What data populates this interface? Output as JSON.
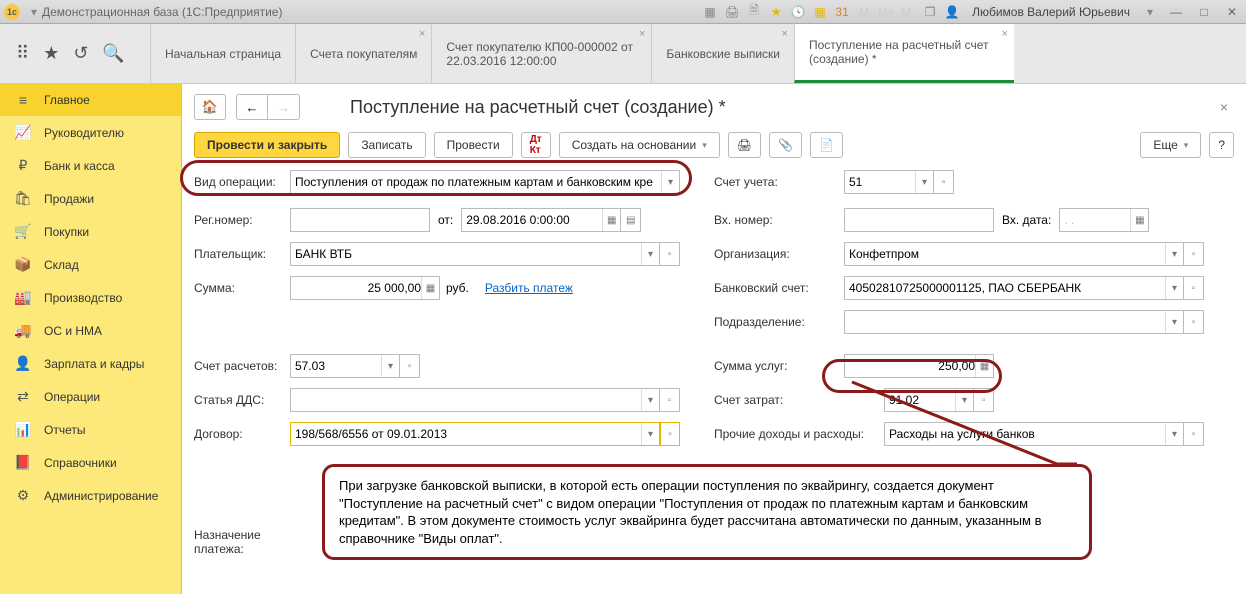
{
  "titlebar": {
    "title": "Демонстрационная база  (1С:Предприятие)",
    "user": "Любимов Валерий Юрьевич"
  },
  "tabs": [
    {
      "label": "Начальная страница",
      "closable": false
    },
    {
      "label": "Счета покупателям",
      "closable": true
    },
    {
      "label": "Счет покупателю КП00-000002 от 22.03.2016 12:00:00",
      "closable": true
    },
    {
      "label": "Банковские выписки",
      "closable": true
    },
    {
      "label": "Поступление на расчетный счет (создание) *",
      "closable": true,
      "active": true
    }
  ],
  "sidebar": [
    {
      "icon": "≡",
      "label": "Главное",
      "active": true
    },
    {
      "icon": "📈",
      "label": "Руководителю"
    },
    {
      "icon": "₽",
      "label": "Банк и касса"
    },
    {
      "icon": "🛍",
      "label": "Продажи"
    },
    {
      "icon": "🛒",
      "label": "Покупки"
    },
    {
      "icon": "📦",
      "label": "Склад"
    },
    {
      "icon": "🏭",
      "label": "Производство"
    },
    {
      "icon": "🚚",
      "label": "ОС и НМА"
    },
    {
      "icon": "👤",
      "label": "Зарплата и кадры"
    },
    {
      "icon": "⇄",
      "label": "Операции"
    },
    {
      "icon": "📊",
      "label": "Отчеты"
    },
    {
      "icon": "📕",
      "label": "Справочники"
    },
    {
      "icon": "⚙",
      "label": "Администрирование"
    }
  ],
  "doc": {
    "title": "Поступление на расчетный счет (создание) *"
  },
  "cmd": {
    "post_close": "Провести и закрыть",
    "save": "Записать",
    "post": "Провести",
    "create_on": "Создать на основании",
    "more": "Еще"
  },
  "labels": {
    "op_type": "Вид операции:",
    "reg_no": "Рег.номер:",
    "from": "от:",
    "payer": "Плательщик:",
    "sum": "Сумма:",
    "rub": "руб.",
    "split": "Разбить платеж",
    "acc_settle": "Счет расчетов:",
    "dds": "Статья ДДС:",
    "contract": "Договор:",
    "purpose": "Назначение платежа:",
    "account": "Счет учета:",
    "in_no": "Вх. номер:",
    "in_date": "Вх. дата:",
    "org": "Организация:",
    "bank_acc": "Банковский счет:",
    "dept": "Подразделение:",
    "svc_sum": "Сумма услуг:",
    "acc_cost": "Счет затрат:",
    "other": "Прочие доходы и расходы:"
  },
  "values": {
    "op_type": "Поступления от продаж по платежным картам и банковским кре",
    "date": "29.08.2016  0:00:00",
    "payer": "БАНК ВТБ",
    "sum": "25 000,00",
    "acc_settle": "57.03",
    "contract": "198/568/6556 от 09.01.2013",
    "account": "51",
    "org": "Конфетпром",
    "bank_acc": "40502810725000001125, ПАО СБЕРБАНК",
    "svc_sum": "250,00",
    "acc_cost": "91.02",
    "other": "Расходы на услуги банков",
    "in_date_placeholder": "  .  .    "
  },
  "callout": {
    "text": "При загрузке банковской выписки, в которой есть операции поступления по эквайрингу, создается документ \"Поступление на расчетный счет\" с видом операции \"Поступления от продаж по платежным картам и банковским кредитам\". В этом документе стоимость услуг эквайринга будет рассчитана автоматически по данным, указанным в справочнике \"Виды оплат\"."
  }
}
